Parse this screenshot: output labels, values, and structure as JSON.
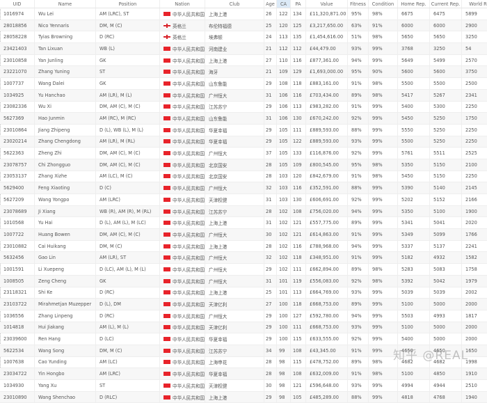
{
  "table": {
    "sorted_column": "CA",
    "columns": [
      "UID",
      "Name",
      "Position",
      "Nation",
      "Club",
      "Age",
      "CA",
      "PA",
      "Value",
      "Fitness",
      "Condition",
      "Home Rep.",
      "Current Rep.",
      "World Rep."
    ],
    "rows": [
      [
        "1016974",
        "Wu Lei",
        "AM (LRC), ST",
        "cn",
        "中华人民共和国",
        "上海上港",
        "26",
        "122",
        "134",
        "£11,320,871.00",
        "95%",
        "98%",
        "6675",
        "6475",
        "5899"
      ],
      [
        "28018856",
        "Nico Yennaris",
        "DM, M (C)",
        "en",
        "英格兰",
        "布伦特福德",
        "25",
        "120",
        "125",
        "£3,217,650.00",
        "63%",
        "91%",
        "6000",
        "6000",
        "2900"
      ],
      [
        "28058228",
        "Tyias Browning",
        "D (RC)",
        "en",
        "英格兰",
        "埃弗顿",
        "24",
        "113",
        "135",
        "£1,454,616.00",
        "51%",
        "98%",
        "5650",
        "5650",
        "3250"
      ],
      [
        "23421403",
        "Tan Lixuan",
        "WB (L)",
        "cn",
        "中华人民共和国",
        "河南建业",
        "21",
        "112",
        "112",
        "£44,479.00",
        "93%",
        "99%",
        "3768",
        "3250",
        "54"
      ],
      [
        "23010858",
        "Yan Junling",
        "GK",
        "cn",
        "中华人民共和国",
        "上海上港",
        "27",
        "110",
        "116",
        "£877,361.00",
        "94%",
        "99%",
        "5649",
        "5499",
        "2570"
      ],
      [
        "23221070",
        "Zhang Yuning",
        "ST",
        "cn",
        "中华人民共和国",
        "海牙",
        "21",
        "109",
        "129",
        "£1,693,000.00",
        "95%",
        "90%",
        "5600",
        "5600",
        "3750"
      ],
      [
        "1007737",
        "Wang Dalei",
        "GK",
        "cn",
        "中华人民共和国",
        "山东鲁能",
        "29",
        "108",
        "118",
        "£883,161.00",
        "91%",
        "98%",
        "5500",
        "5500",
        "2500"
      ],
      [
        "1034925",
        "Yu Hanchao",
        "AM (LR), M (L)",
        "cn",
        "中华人民共和国",
        "广州恒大",
        "31",
        "106",
        "116",
        "£703,434.00",
        "89%",
        "98%",
        "5417",
        "5267",
        "2341"
      ],
      [
        "23082336",
        "Wu Xi",
        "DM, AM (C), M (C)",
        "cn",
        "中华人民共和国",
        "江苏苏宁",
        "29",
        "106",
        "113",
        "£983,282.00",
        "91%",
        "99%",
        "5400",
        "5300",
        "2250"
      ],
      [
        "5627369",
        "Hao Junmin",
        "AM (RC), M (RC)",
        "cn",
        "中华人民共和国",
        "山东鲁能",
        "31",
        "106",
        "130",
        "£670,242.00",
        "92%",
        "99%",
        "5450",
        "5250",
        "1750"
      ],
      [
        "23010864",
        "Jiang Zhipeng",
        "D (L), WB (L), M (L)",
        "cn",
        "中华人民共和国",
        "华夏幸福",
        "29",
        "105",
        "111",
        "£889,593.00",
        "88%",
        "99%",
        "5550",
        "5250",
        "2250"
      ],
      [
        "23020214",
        "Zhang Chengdong",
        "AM (LR), M (RL)",
        "cn",
        "中华人民共和国",
        "华夏幸福",
        "29",
        "105",
        "122",
        "£889,593.00",
        "93%",
        "99%",
        "5500",
        "5250",
        "2250"
      ],
      [
        "5622363",
        "Zheng Zhi",
        "DM, AM (C), M (C)",
        "cn",
        "中华人民共和国",
        "广州恒大",
        "37",
        "105",
        "133",
        "£116,876.00",
        "92%",
        "99%",
        "5761",
        "5511",
        "2525"
      ],
      [
        "23078757",
        "Chi Zhongguo",
        "DM, AM (C), M (C)",
        "cn",
        "中华人民共和国",
        "北京国安",
        "28",
        "105",
        "109",
        "£800,545.00",
        "95%",
        "98%",
        "5350",
        "5150",
        "2100"
      ],
      [
        "23053137",
        "Zhang Xizhe",
        "AM (LC), M (C)",
        "cn",
        "中华人民共和国",
        "北京国安",
        "28",
        "103",
        "120",
        "£842,679.00",
        "91%",
        "98%",
        "5450",
        "5150",
        "2250"
      ],
      [
        "5629400",
        "Feng Xiaoting",
        "D (C)",
        "cn",
        "中华人民共和国",
        "广州恒大",
        "32",
        "103",
        "116",
        "£352,591.00",
        "88%",
        "99%",
        "5390",
        "5140",
        "2145"
      ],
      [
        "5627209",
        "Wang Yongpo",
        "AM (LRC)",
        "cn",
        "中华人民共和国",
        "天津权健",
        "31",
        "103",
        "130",
        "£606,691.00",
        "92%",
        "99%",
        "5202",
        "5152",
        "2166"
      ],
      [
        "23078689",
        "Ji Xiang",
        "WB (R), AM (R), M (RL)",
        "cn",
        "中华人民共和国",
        "江苏苏宁",
        "28",
        "102",
        "108",
        "£756,020.00",
        "94%",
        "99%",
        "5350",
        "5100",
        "1900"
      ],
      [
        "1010568",
        "Yu Hai",
        "D (L), AM (L), M (LC)",
        "cn",
        "中华人民共和国",
        "上海上港",
        "31",
        "102",
        "121",
        "£557,775.00",
        "89%",
        "99%",
        "5341",
        "5041",
        "2020"
      ],
      [
        "1007722",
        "Huang Bowen",
        "DM, AM (C), M (C)",
        "cn",
        "中华人民共和国",
        "广州恒大",
        "30",
        "102",
        "121",
        "£614,863.00",
        "91%",
        "99%",
        "5349",
        "5099",
        "1766"
      ],
      [
        "23010882",
        "Cai Huikang",
        "DM, M (C)",
        "cn",
        "中华人民共和国",
        "上海上港",
        "28",
        "102",
        "116",
        "£788,968.00",
        "94%",
        "99%",
        "5337",
        "5137",
        "2241"
      ],
      [
        "5632456",
        "Gao Lin",
        "AM (LR), ST",
        "cn",
        "中华人民共和国",
        "广州恒大",
        "32",
        "102",
        "118",
        "£348,951.00",
        "91%",
        "99%",
        "5182",
        "4932",
        "1582"
      ],
      [
        "1001591",
        "Li Xuepeng",
        "D (LC), AM (L), M (L)",
        "cn",
        "中华人民共和国",
        "广州恒大",
        "29",
        "102",
        "111",
        "£662,894.00",
        "89%",
        "98%",
        "5283",
        "5083",
        "1758"
      ],
      [
        "1008505",
        "Zeng Cheng",
        "GK",
        "cn",
        "中华人民共和国",
        "广州恒大",
        "31",
        "101",
        "119",
        "£556,083.00",
        "92%",
        "98%",
        "5392",
        "5042",
        "1979"
      ],
      [
        "23118321",
        "Shi Ke",
        "D (RC)",
        "cn",
        "中华人民共和国",
        "上海上港",
        "25",
        "101",
        "113",
        "£664,769.00",
        "93%",
        "99%",
        "5039",
        "5039",
        "2002"
      ],
      [
        "23103722",
        "Mirahmetjan Muzepper",
        "D (L), DM",
        "cn",
        "中华人民共和国",
        "天津亿利",
        "27",
        "100",
        "118",
        "£668,753.00",
        "89%",
        "99%",
        "5100",
        "5000",
        "2000"
      ],
      [
        "1036556",
        "Zhang Linpeng",
        "D (RC)",
        "cn",
        "中华人民共和国",
        "广州恒大",
        "29",
        "100",
        "127",
        "£592,780.00",
        "94%",
        "99%",
        "5503",
        "4993",
        "1817"
      ],
      [
        "1014818",
        "Hui Jiakang",
        "AM (L), M (L)",
        "cn",
        "中华人民共和国",
        "天津亿利",
        "29",
        "100",
        "111",
        "£668,753.00",
        "93%",
        "99%",
        "5100",
        "5000",
        "2000"
      ],
      [
        "23039600",
        "Ren Hang",
        "D (LC)",
        "cn",
        "中华人民共和国",
        "华夏幸福",
        "29",
        "100",
        "115",
        "£633,555.00",
        "92%",
        "99%",
        "5400",
        "5000",
        "2000"
      ],
      [
        "5622534",
        "Wang Song",
        "DM, M (C)",
        "cn",
        "中华人民共和国",
        "江苏苏宁",
        "34",
        "99",
        "108",
        "£43,345.00",
        "91%",
        "99%",
        "4650",
        "4650",
        "1650"
      ],
      [
        "1007638",
        "Cao Yunding",
        "AM (LC)",
        "cn",
        "中华人民共和国",
        "上海申花",
        "28",
        "98",
        "115",
        "£478,752.00",
        "89%",
        "98%",
        "4682",
        "4682",
        "1998"
      ],
      [
        "23034722",
        "Yin Hongbo",
        "AM (LRC)",
        "cn",
        "中华人民共和国",
        "华夏幸福",
        "28",
        "98",
        "108",
        "£632,009.00",
        "91%",
        "98%",
        "5100",
        "4850",
        "1910"
      ],
      [
        "1034930",
        "Yang Xu",
        "ST",
        "cn",
        "中华人民共和国",
        "天津权健",
        "30",
        "98",
        "121",
        "£596,648.00",
        "93%",
        "99%",
        "4994",
        "4944",
        "2510"
      ],
      [
        "23010890",
        "Wang Shenchao",
        "D (RLC)",
        "cn",
        "中华人民共和国",
        "上海上港",
        "29",
        "98",
        "105",
        "£485,289.00",
        "88%",
        "99%",
        "4818",
        "4768",
        "1940"
      ]
    ]
  },
  "watermark": "知乎 @REAL",
  "colors": {
    "sorted_header": "#dceaf7",
    "china_flag": "#e8232a"
  }
}
